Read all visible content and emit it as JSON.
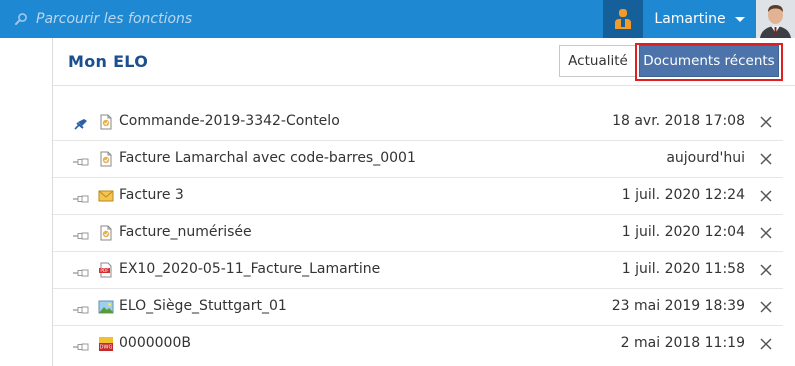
{
  "search": {
    "placeholder": "Parcourir les fonctions"
  },
  "user": {
    "name": "Lamartine"
  },
  "page": {
    "title": "Mon ELO"
  },
  "tabs": {
    "news_label": "Actualité",
    "recent_label": "Documents récents"
  },
  "colors": {
    "topbar": "#1e88d2",
    "accent_tab": "#4d74aa",
    "highlight": "#e02020",
    "title": "#1b4f8f"
  },
  "documents": [
    {
      "name": "Commande-2019-3342-Contelo",
      "date": "18 avr. 2018 17:08",
      "pinned": true,
      "icon": "document-icon"
    },
    {
      "name": "Facture Lamarchal avec code-barres_0001",
      "date": "aujourd'hui",
      "pinned": false,
      "icon": "document-icon"
    },
    {
      "name": "Facture 3",
      "date": "1 juil. 2020 12:24",
      "pinned": false,
      "icon": "email-icon"
    },
    {
      "name": "Facture_numérisée",
      "date": "1 juil. 2020 12:04",
      "pinned": false,
      "icon": "document-icon"
    },
    {
      "name": "EX10_2020-05-11_Facture_Lamartine",
      "date": "1 juil. 2020 11:58",
      "pinned": false,
      "icon": "pdf-icon"
    },
    {
      "name": "ELO_Siège_Stuttgart_01",
      "date": "23 mai 2019 18:39",
      "pinned": false,
      "icon": "image-icon"
    },
    {
      "name": "0000000B",
      "date": "2 mai 2018 11:19",
      "pinned": false,
      "icon": "dwg-icon"
    }
  ]
}
